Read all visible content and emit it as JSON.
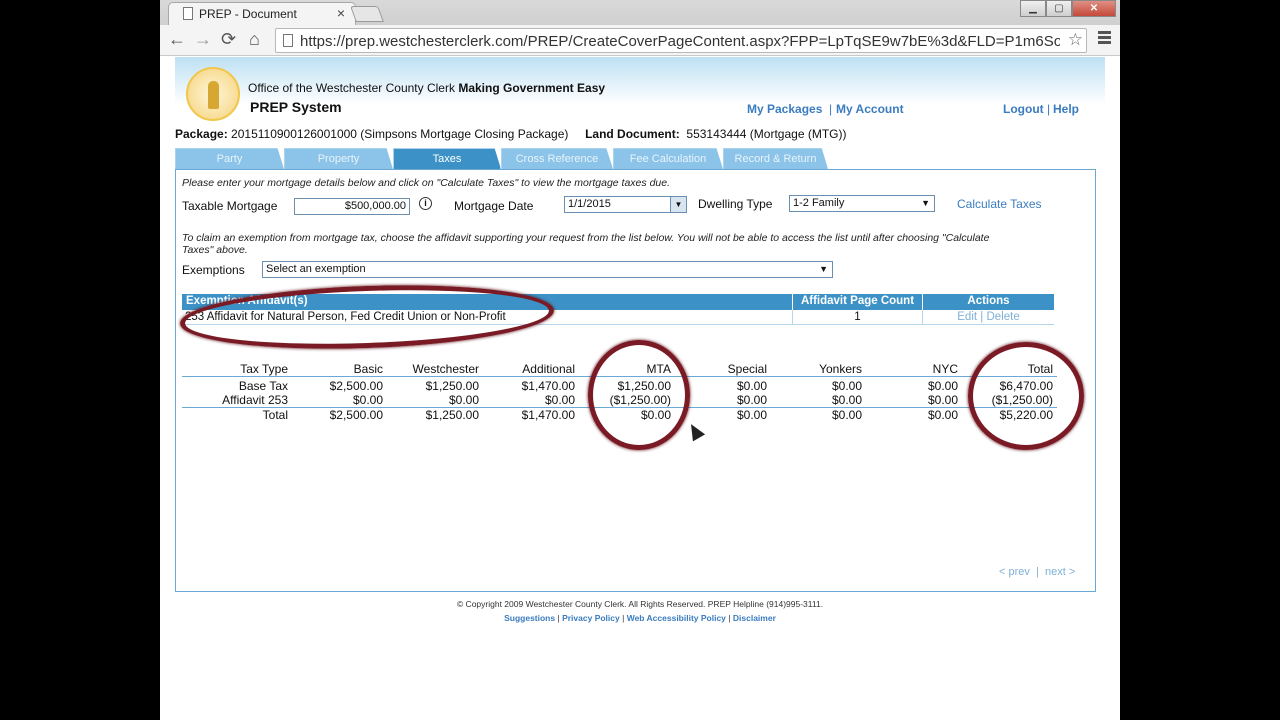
{
  "browser": {
    "tab_title": "PREP - Document",
    "tab_close": "×",
    "url": "https://prep.westchesterclerk.com/PREP/CreateCoverPageContent.aspx?FPP=LpTqSE9w7bE%3d&FLD=P1m6SoKjZ10",
    "back_icon": "arrow-left-icon",
    "forward_icon": "arrow-right-icon",
    "reload_icon": "reload-icon",
    "home_icon": "home-icon",
    "star_icon": "star-icon",
    "glyphs": {
      "back": "←",
      "forward": "→",
      "reload": "⟳",
      "home": "⌂",
      "star": "☆",
      "min": "▁",
      "max": "▢",
      "close": "✕"
    }
  },
  "header": {
    "office": "Office of the Westchester County Clerk",
    "slogan": "Making Government Easy",
    "system": "PREP System",
    "my_packages": "My Packages",
    "my_account": "My Account",
    "logout": "Logout",
    "help": "Help",
    "sep": "|"
  },
  "package": {
    "package_label": "Package:",
    "package_value": "201511090012600100​0 (Simpsons Mortgage Closing Package)",
    "doc_label": "Land Document:",
    "doc_value": "553143444 (Mortgage (MTG))"
  },
  "tabs": [
    "Party",
    "Property",
    "Taxes",
    "Cross Reference",
    "Fee Calculation",
    "Record & Return"
  ],
  "taxes": {
    "instruction1": "Please enter your mortgage details below and click on \"Calculate Taxes\" to view the mortgage taxes due.",
    "taxable_label": "Taxable Mortgage",
    "taxable_value": "$500,000.00",
    "info": "i",
    "date_label": "Mortgage Date",
    "date_value": "1/1/2015",
    "dwelling_label": "Dwelling Type",
    "dwelling_value": "1-2 Family",
    "calc_link": "Calculate Taxes",
    "instruction2": "To claim an exemption from mortgage tax, choose the affidavit supporting your request from the list below. You will not be able to access the list until after choosing \"Calculate",
    "instruction2b": "Taxes\" above.",
    "exemptions_label": "Exemptions",
    "exemptions_value": "Select an exemption",
    "dd_arrow": "▼"
  },
  "affidavits": {
    "headers": [
      "Exemption Affidavit(s)",
      "Affidavit Page Count",
      "Actions"
    ],
    "rows": [
      {
        "name": "253 Affidavit for Natural Person, Fed Credit Union or Non-Profit",
        "count": "1",
        "edit": "Edit",
        "sep": "|",
        "delete": "Delete"
      }
    ]
  },
  "tax_table": {
    "headers": [
      "Tax Type",
      "Basic",
      "Westchester",
      "Additional",
      "MTA",
      "Special",
      "Yonkers",
      "NYC",
      "Total"
    ],
    "rows": [
      [
        "Base Tax",
        "$2,500.00",
        "$1,250.00",
        "$1,470.00",
        "$1,250.00",
        "$0.00",
        "$0.00",
        "$0.00",
        "$6,470.00"
      ],
      [
        "Affidavit 253",
        "$0.00",
        "$0.00",
        "$0.00",
        "($1,250.00)",
        "$0.00",
        "$0.00",
        "$0.00",
        "($1,250.00)"
      ],
      [
        "Total",
        "$2,500.00",
        "$1,250.00",
        "$1,470.00",
        "$0.00",
        "$0.00",
        "$0.00",
        "$0.00",
        "$5,220.00"
      ]
    ]
  },
  "pager": {
    "prev": "< prev",
    "sep": "|",
    "next": "next >"
  },
  "footer": {
    "copyright": "© Copyright 2009 Westchester County Clerk. All Rights Reserved. PREP Helpline (914)995-3111.",
    "links": [
      "Suggestions",
      "Privacy Policy",
      "Web Accessibility Policy",
      "Disclaimer"
    ],
    "sep": "|"
  }
}
